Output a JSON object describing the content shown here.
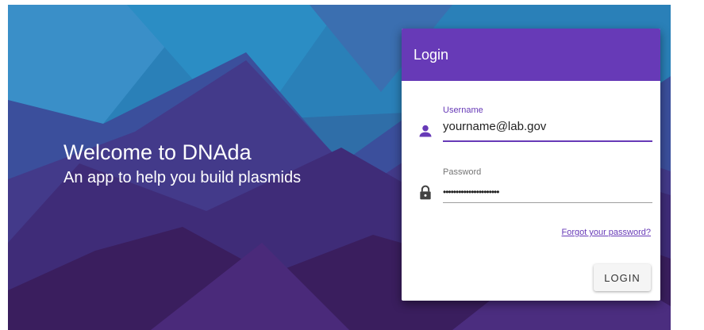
{
  "welcome": {
    "title": "Welcome to DNAda",
    "subtitle": "An app to help you build plasmids"
  },
  "login_card": {
    "title": "Login",
    "header_color": "#673ab7",
    "username": {
      "label": "Username",
      "value": "yourname@lab.gov",
      "icon": "person-icon"
    },
    "password": {
      "label": "Password",
      "value": "••••••••••••••••••••••",
      "icon": "lock-icon"
    },
    "forgot_link": "Forgot your password?",
    "login_button": "LOGIN"
  },
  "colors": {
    "accent": "#673ab7",
    "background_dark": "#3a1e5e",
    "background_light": "#2a7fb8"
  }
}
